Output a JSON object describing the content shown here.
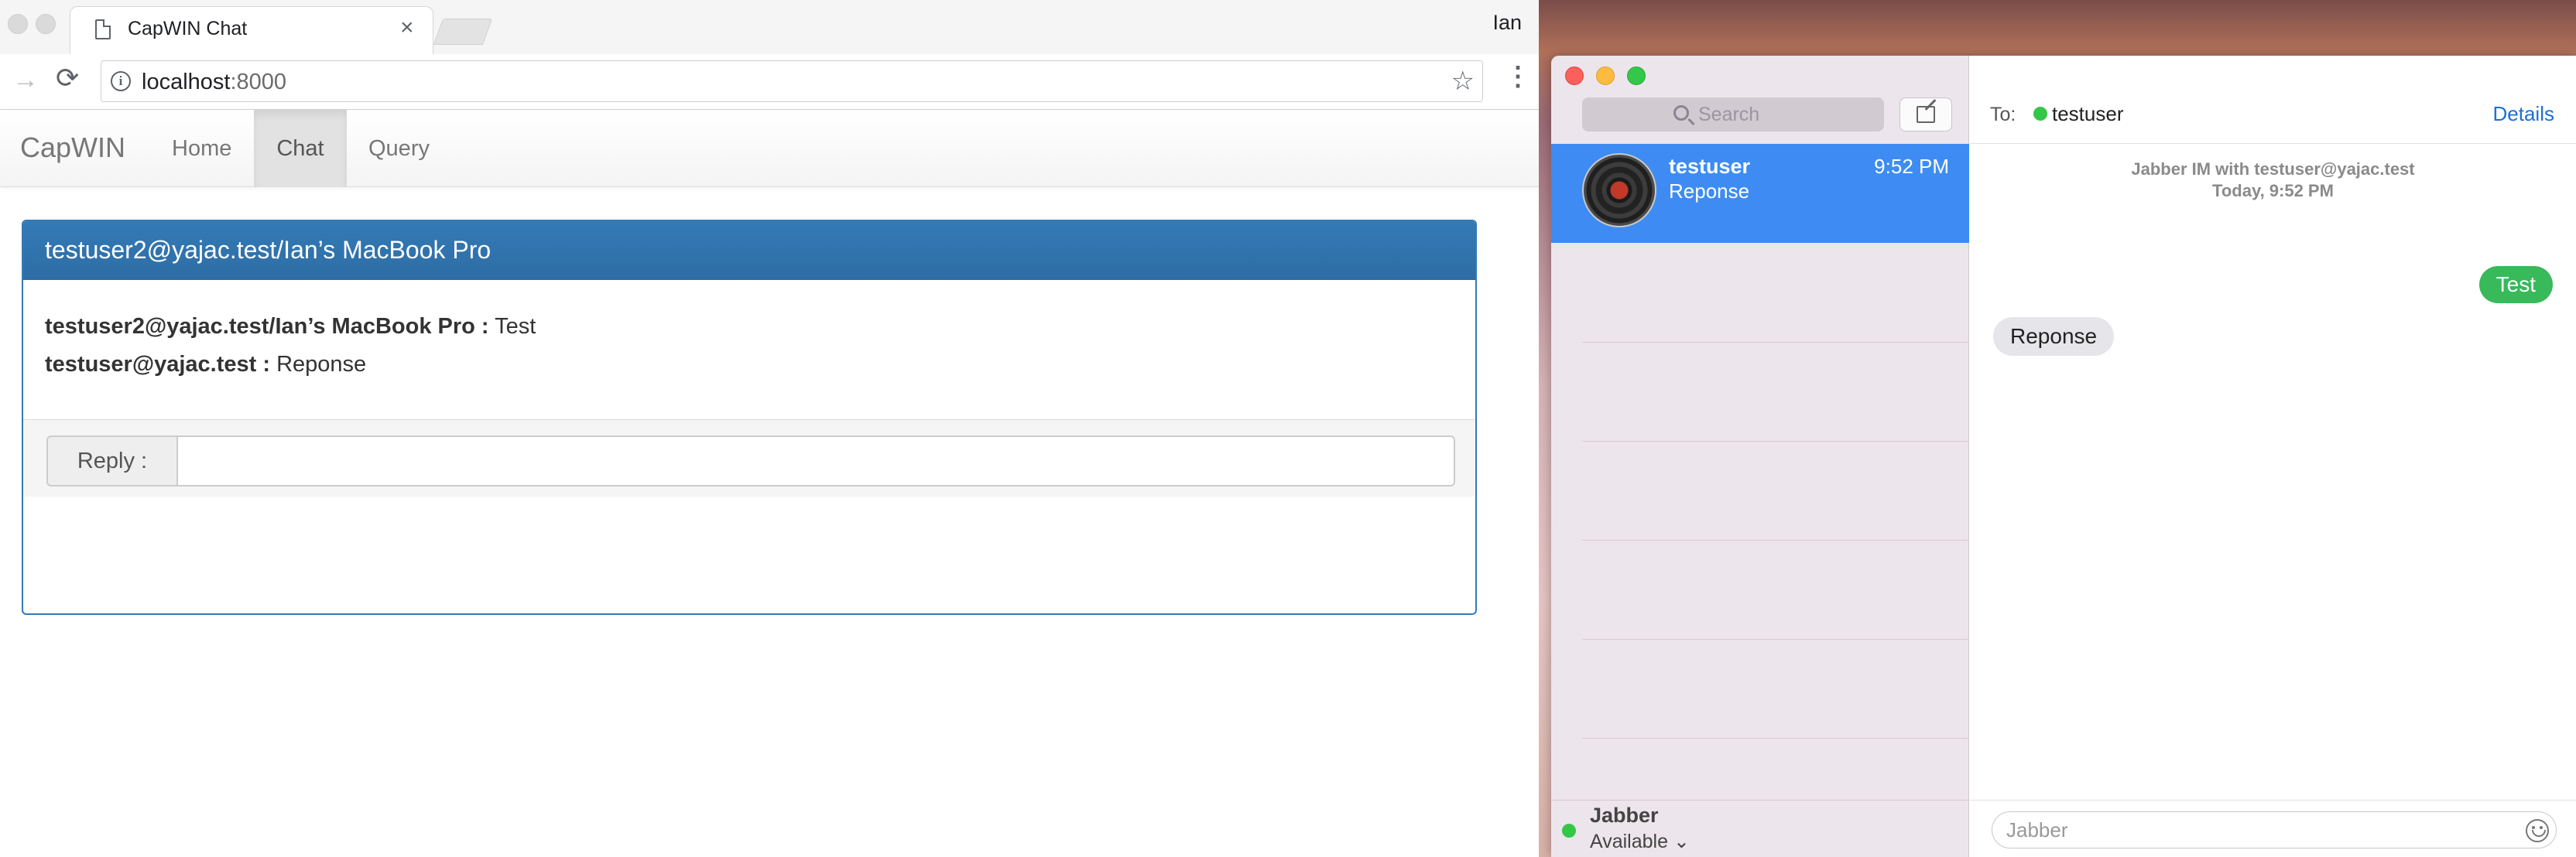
{
  "browser": {
    "tab_title": "CapWIN Chat",
    "tab_close": "×",
    "profile_name": "Ian",
    "url_host": "localhost",
    "url_port": ":8000",
    "icons": {
      "forward": "→",
      "reload": "⟳",
      "info": "i",
      "star": "☆",
      "menu": "⋮"
    }
  },
  "app": {
    "brand": "CapWIN",
    "nav": [
      {
        "label": "Home",
        "active": false
      },
      {
        "label": "Chat",
        "active": true
      },
      {
        "label": "Query",
        "active": false
      }
    ],
    "panel": {
      "title": "testuser2@yajac.test/Ian’s MacBook Pro",
      "messages": [
        {
          "sender": "testuser2@yajac.test/Ian’s MacBook Pro :",
          "text": " Test"
        },
        {
          "sender": "testuser@yajac.test :",
          "text": " Reponse"
        }
      ],
      "reply_label": "Reply :",
      "reply_value": ""
    },
    "colors": {
      "primary": "#337ab7"
    }
  },
  "messages_app": {
    "search_placeholder": "Search",
    "conversation": {
      "name": "testuser",
      "preview": "Reponse",
      "time": "9:52 PM"
    },
    "account": {
      "name": "Jabber",
      "status": "Available ⌄"
    },
    "to_label": "To:",
    "to_name": "testuser",
    "details_label": "Details",
    "header_line1": "Jabber IM with testuser@yajac.test",
    "header_line2": "Today, 9:52 PM",
    "outgoing": "Test",
    "incoming": "Reponse",
    "compose_placeholder": "Jabber",
    "colors": {
      "selection": "#3e8cf3",
      "outgoing_bubble": "#38b95a",
      "incoming_bubble": "#e5e5ea",
      "online": "#33c748"
    }
  }
}
